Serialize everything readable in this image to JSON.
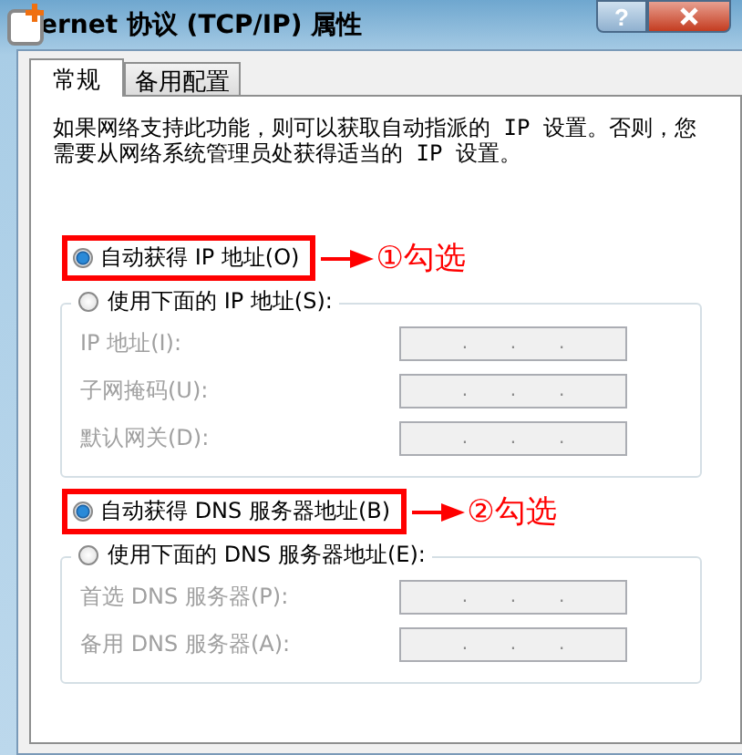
{
  "window": {
    "title": "ernet 协议 (TCP/IP) 属性",
    "help": "?"
  },
  "tabs": [
    {
      "label": "常规",
      "selected": true
    },
    {
      "label": "备用配置",
      "selected": false
    }
  ],
  "description": "如果网络支持此功能，则可以获取自动指派的 IP 设置。否则，您需要从网络系统管理员处获得适当的 IP 设置。",
  "sections": [
    {
      "auto": {
        "label": "自动获得 IP 地址(O)",
        "selected": true,
        "note": "①勾选"
      },
      "manual": {
        "label": "使用下面的 IP 地址(S):",
        "selected": false
      },
      "fields": [
        {
          "label": "IP 地址(I):",
          "disabled": true,
          "separators": [
            ".",
            ".",
            "."
          ]
        },
        {
          "label": "子网掩码(U):",
          "disabled": true,
          "separators": [
            ".",
            ".",
            "."
          ]
        },
        {
          "label": "默认网关(D):",
          "disabled": true,
          "separators": [
            ".",
            ".",
            "."
          ]
        }
      ]
    },
    {
      "auto": {
        "label": "自动获得 DNS 服务器地址(B)",
        "selected": true,
        "note": "②勾选"
      },
      "manual": {
        "label": "使用下面的 DNS 服务器地址(E):",
        "selected": false
      },
      "fields": [
        {
          "label": "首选 DNS 服务器(P):",
          "disabled": true,
          "separators": [
            ".",
            ".",
            "."
          ]
        },
        {
          "label": "备用 DNS 服务器(A):",
          "disabled": true,
          "separators": [
            ".",
            ".",
            "."
          ]
        }
      ]
    }
  ]
}
